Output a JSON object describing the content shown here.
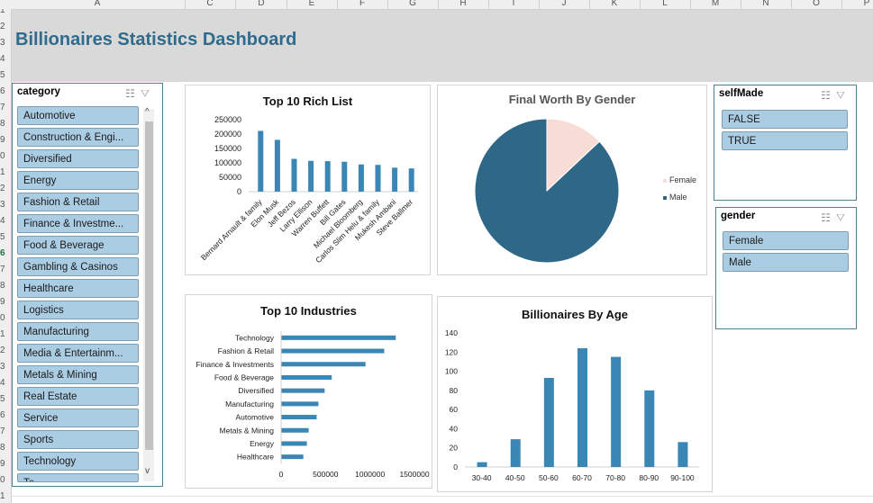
{
  "spreadsheet": {
    "columns": [
      "A",
      "C",
      "D",
      "E",
      "F",
      "G",
      "H",
      "I",
      "J",
      "K",
      "L",
      "M",
      "N",
      "O",
      "P"
    ],
    "rows": [
      "1",
      "2",
      "3",
      "4",
      "5",
      "6",
      "7",
      "8",
      "9",
      "0",
      "1",
      "2",
      "3",
      "4",
      "5",
      "6",
      "7",
      "8",
      "9",
      "0",
      "1",
      "2",
      "3",
      "4",
      "5",
      "6",
      "7",
      "8",
      "9",
      "0",
      "1"
    ],
    "selected_row": "6"
  },
  "dashboard": {
    "title": "Billionaires Statistics Dashboard"
  },
  "slicers": {
    "category": {
      "title": "category",
      "items": [
        "Automotive",
        "Construction & Engi...",
        "Diversified",
        "Energy",
        "Fashion & Retail",
        "Finance & Investme...",
        "Food & Beverage",
        "Gambling & Casinos",
        "Healthcare",
        "Logistics",
        "Manufacturing",
        "Media & Entertainm...",
        "Metals & Mining",
        "Real Estate",
        "Service",
        "Sports",
        "Technology",
        "Te..."
      ]
    },
    "selfMade": {
      "title": "selfMade",
      "items": [
        "FALSE",
        "TRUE"
      ]
    },
    "gender": {
      "title": "gender",
      "items": [
        "Female",
        "Male"
      ]
    },
    "icons": [
      "multi-select-icon",
      "clear-filter-icon"
    ]
  },
  "charts": {
    "rich_list": {
      "title": "Top 10 Rich List",
      "type": "bar",
      "color": "#3a86b4",
      "categories": [
        "Bernard Arnault & family",
        "Elon Musk",
        "Jeff Bezos",
        "Larry Ellison",
        "Warren Buffett",
        "Bill Gates",
        "Michael Bloomberg",
        "Carlos Slim Helu & family",
        "Mukesh Ambani",
        "Steve Ballmer"
      ],
      "values": [
        211000,
        180000,
        114000,
        107000,
        106000,
        104000,
        94500,
        93000,
        83400,
        80700
      ],
      "yticks": [
        "0",
        "50000",
        "100000",
        "150000",
        "200000",
        "250000"
      ],
      "ylim": [
        0,
        250000
      ]
    },
    "gender_pie": {
      "title": "Final Worth By Gender",
      "type": "pie",
      "slices": [
        {
          "name": "Female",
          "value": 13,
          "color": "#f8dcd6"
        },
        {
          "name": "Male",
          "value": 87,
          "color": "#2f6787"
        }
      ]
    },
    "industries": {
      "title": "Top 10 Industries",
      "type": "bar",
      "orientation": "horizontal",
      "color": "#3a86b4",
      "categories": [
        "Technology",
        "Fashion & Retail",
        "Finance & Investments",
        "Food & Beverage",
        "Diversified",
        "Manufacturing",
        "Automotive",
        "Metals & Mining",
        "Energy",
        "Healthcare"
      ],
      "values": [
        1290000,
        1160000,
        950000,
        570000,
        490000,
        420000,
        400000,
        310000,
        290000,
        250000
      ],
      "xticks": [
        "0",
        "500000",
        "1000000",
        "1500000"
      ],
      "xlim": [
        0,
        1500000
      ]
    },
    "age": {
      "title": "Billionaires By Age",
      "type": "bar",
      "color": "#3a86b4",
      "categories": [
        "30-40",
        "40-50",
        "50-60",
        "60-70",
        "70-80",
        "80-90",
        "90-100"
      ],
      "values": [
        5,
        29,
        93,
        124,
        115,
        80,
        26
      ],
      "yticks": [
        "0",
        "20",
        "40",
        "60",
        "80",
        "100",
        "120",
        "140"
      ],
      "ylim": [
        0,
        140
      ]
    }
  }
}
